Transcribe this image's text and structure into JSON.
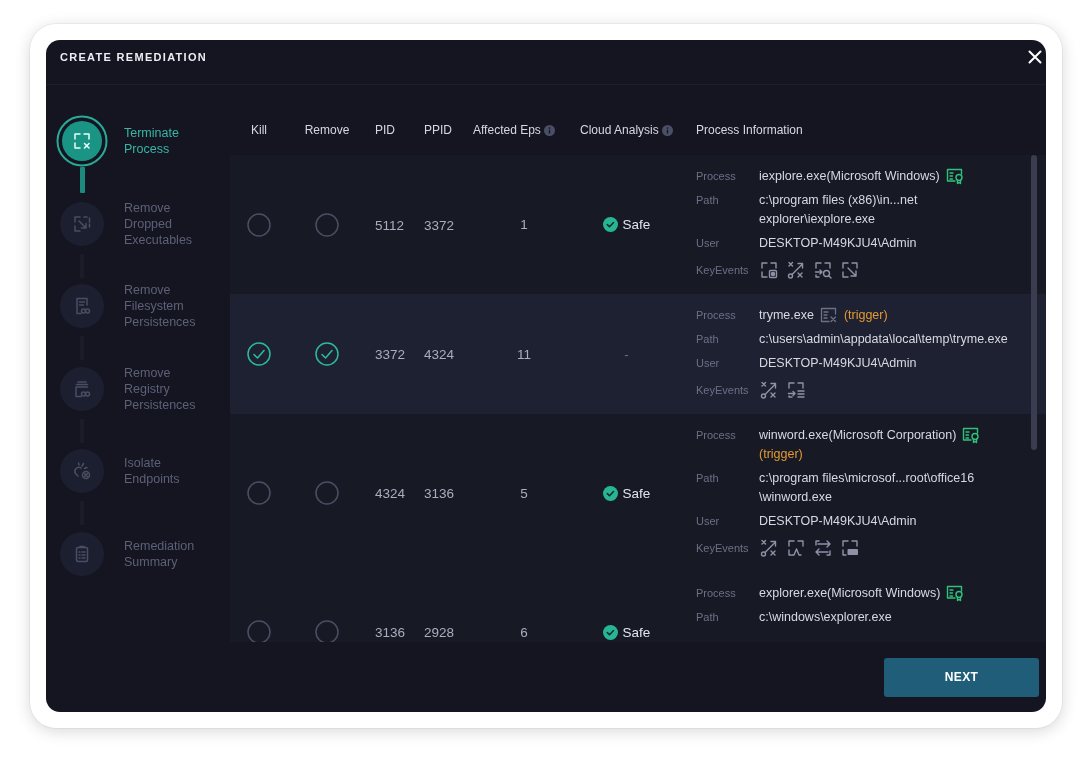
{
  "dialog": {
    "title": "CREATE REMEDIATION"
  },
  "steps": [
    {
      "kind": "terminate",
      "label": "Terminate Process",
      "selected": true
    },
    {
      "kind": "drop",
      "label": "Remove Dropped Executables",
      "selected": false
    },
    {
      "kind": "filesystem",
      "label": "Remove Filesystem Persistences",
      "selected": false
    },
    {
      "kind": "registry",
      "label": "Remove Registry Persistences",
      "selected": false
    },
    {
      "kind": "isolate",
      "label": "Isolate Endpoints",
      "selected": false
    },
    {
      "kind": "summary",
      "label": "Remediation Summary",
      "selected": false
    }
  ],
  "table": {
    "columns": [
      {
        "label": "Kill",
        "info_icon": false
      },
      {
        "label": "Remove",
        "info_icon": false
      },
      {
        "label": "PID",
        "info_icon": false
      },
      {
        "label": "PPID",
        "info_icon": false
      },
      {
        "label": "Affected Eps",
        "info_icon": true
      },
      {
        "label": "Cloud Analysis",
        "info_icon": true
      },
      {
        "label": "Process Information",
        "info_icon": false
      }
    ],
    "rows": [
      {
        "selected": false,
        "kill_checked": false,
        "remove_checked": false,
        "pid": "5112",
        "ppid": "3372",
        "affected_eps": "1",
        "cloud_analysis": {
          "kind": "safe",
          "label": "Safe"
        },
        "process_info": [
          {
            "kind": "process",
            "label": "Process",
            "value": "iexplore.exe(Microsoft Windows)",
            "signed": true
          },
          {
            "kind": "path",
            "label": "Path",
            "lines": [
              "c:\\program files (x86)\\in...net",
              "explorer\\iexplore.exe"
            ]
          },
          {
            "kind": "text",
            "label": "User",
            "value": "DESKTOP-M49KJU4\\Admin"
          },
          {
            "kind": "events",
            "label": "KeyEvents",
            "events": [
              {
                "kind": "capture"
              },
              {
                "kind": "unlink"
              },
              {
                "kind": "scan"
              },
              {
                "kind": "drop"
              }
            ]
          }
        ]
      },
      {
        "selected": true,
        "kill_checked": true,
        "remove_checked": true,
        "pid": "3372",
        "ppid": "4324",
        "affected_eps": "11",
        "cloud_analysis": {
          "kind": "none",
          "label": "-"
        },
        "process_info": [
          {
            "kind": "process",
            "label": "Process",
            "value": "tryme.exe",
            "signed": false,
            "tag": "(trigger)"
          },
          {
            "kind": "path",
            "label": "Path",
            "lines": [
              "c:\\users\\admin\\appdata\\local\\temp\\tryme.exe"
            ]
          },
          {
            "kind": "text",
            "label": "User",
            "value": "DESKTOP-M49KJU4\\Admin"
          },
          {
            "kind": "events",
            "label": "KeyEvents",
            "events": [
              {
                "kind": "unlink"
              },
              {
                "kind": "inject"
              }
            ]
          }
        ]
      },
      {
        "selected": false,
        "kill_checked": false,
        "remove_checked": false,
        "pid": "4324",
        "ppid": "3136",
        "affected_eps": "5",
        "cloud_analysis": {
          "kind": "safe",
          "label": "Safe"
        },
        "process_info": [
          {
            "kind": "process",
            "label": "Process",
            "value": "winword.exe(Microsoft Corporation)",
            "signed": true,
            "tag": "(trigger)"
          },
          {
            "kind": "path",
            "label": "Path",
            "lines": [
              "c:\\program files\\microsof...root\\office16",
              "\\winword.exe"
            ]
          },
          {
            "kind": "text",
            "label": "User",
            "value": "DESKTOP-M49KJU4\\Admin"
          },
          {
            "kind": "events",
            "label": "KeyEvents",
            "events": [
              {
                "kind": "unlink"
              },
              {
                "kind": "pulse"
              },
              {
                "kind": "swap"
              },
              {
                "kind": "keyboard"
              }
            ]
          }
        ]
      },
      {
        "selected": false,
        "kill_checked": false,
        "remove_checked": false,
        "pid": "3136",
        "ppid": "2928",
        "affected_eps": "6",
        "cloud_analysis": {
          "kind": "safe",
          "label": "Safe"
        },
        "process_info": [
          {
            "kind": "process",
            "label": "Process",
            "value": "explorer.exe(Microsoft Windows)",
            "signed": true
          },
          {
            "kind": "path",
            "label": "Path",
            "lines": [
              "c:\\windows\\explorer.exe"
            ]
          }
        ]
      }
    ]
  },
  "footer": {
    "next_button": "NEXT"
  }
}
